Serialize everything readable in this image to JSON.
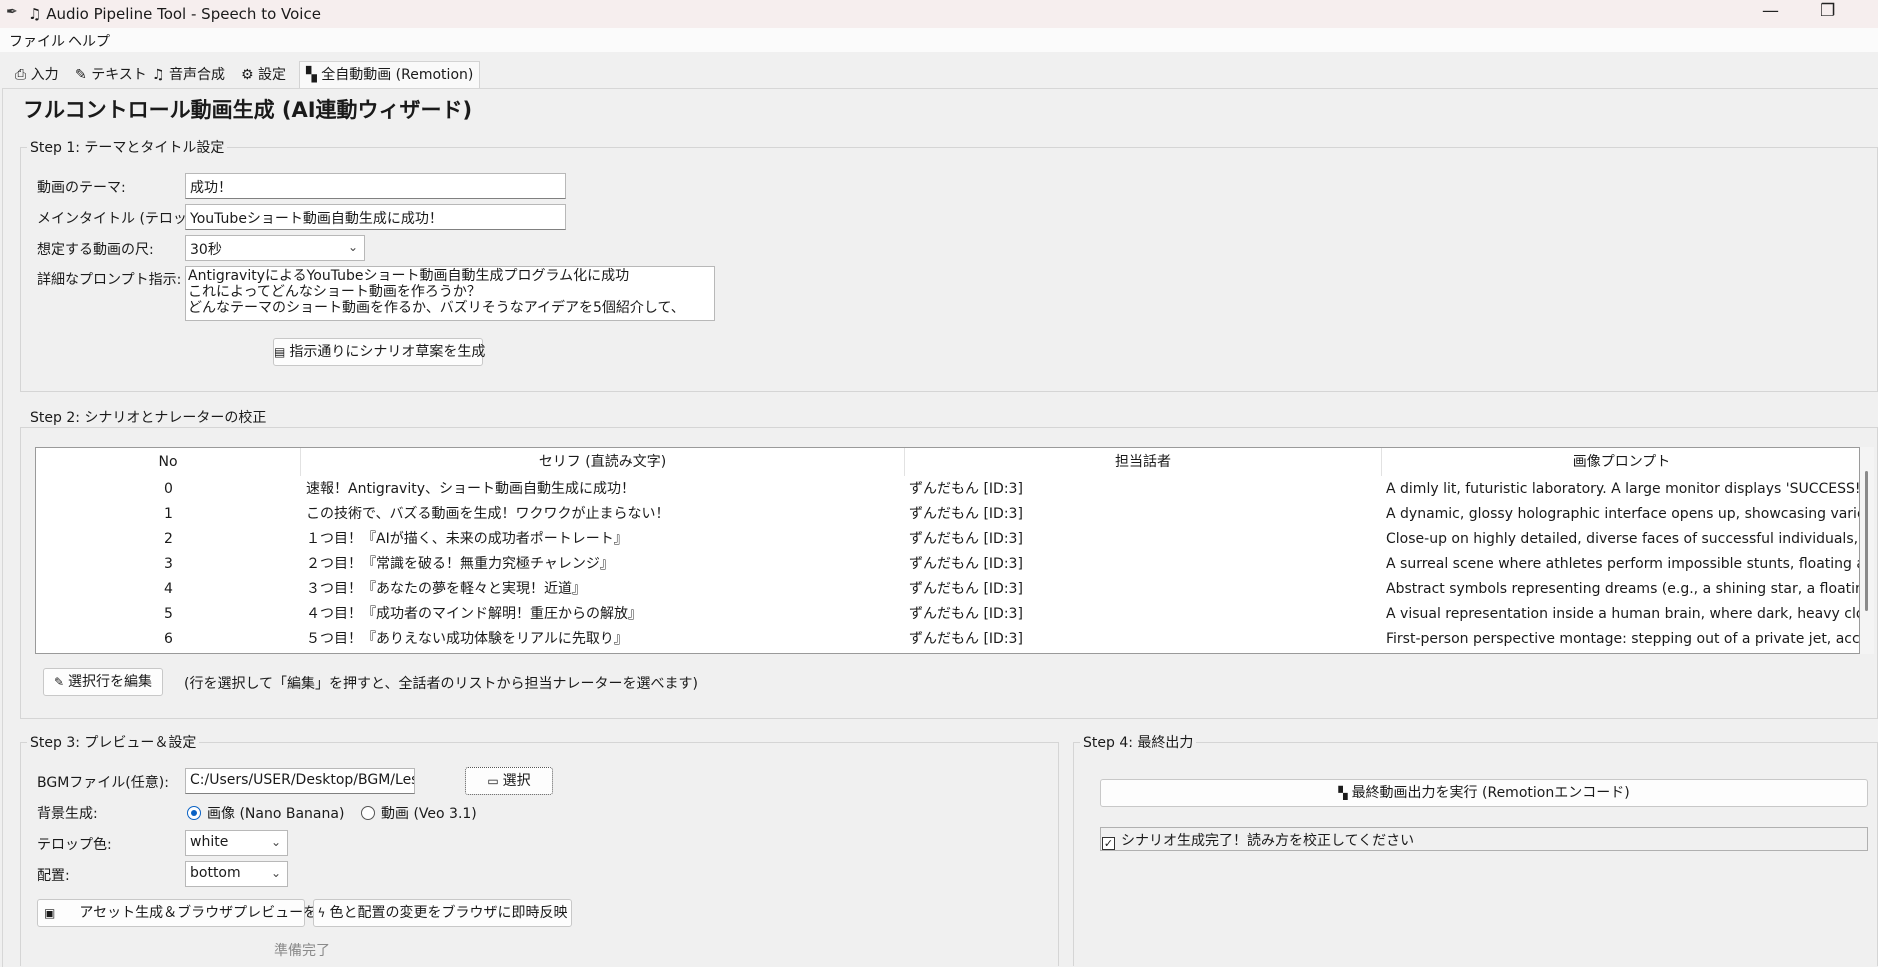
{
  "window": {
    "title": "Audio Pipeline Tool - Speech to Voice",
    "minimize_glyph": "—",
    "restore_glyph": "❐"
  },
  "menu": {
    "items": [
      "ファイル",
      "ヘルプ"
    ]
  },
  "tabs": [
    {
      "label": "入力",
      "icon": "import-icon"
    },
    {
      "label": "テキスト",
      "icon": "pencil-icon"
    },
    {
      "label": "音声合成",
      "icon": "music-note-icon"
    },
    {
      "label": "設定",
      "icon": "gear-icon"
    },
    {
      "label": "全自動動画 (Remotion)",
      "icon": "clapper-icon",
      "active": true
    }
  ],
  "heading": "フルコントロール動画生成 (AI連動ウィザード)",
  "step1": {
    "title": "Step 1: テーマとタイトル設定",
    "theme_label": "動画のテーマ:",
    "theme_value": "成功！",
    "main_title_label": "メインタイトル (テロップ):",
    "main_title_value": "YouTubeショート動画自動生成に成功！",
    "duration_label": "想定する動画の尺:",
    "duration_value": "30秒",
    "prompt_label": "詳細なプロンプト指示:",
    "prompt_lines": [
      "AntigravityによるYouTubeショート動画自動生成プログラム化に成功",
      "これによってどんなショート動画を作ろうか？",
      "どんなテーマのショート動画を作るか、バズリそうなアイデアを5個紹介して、"
    ],
    "generate_button": "指示通りにシナリオ草案を生成"
  },
  "step2": {
    "title": "Step 2: シナリオとナレーターの校正",
    "columns": [
      "No",
      "セリフ (直読み文字)",
      "担当話者",
      "画像プロンプト"
    ],
    "rows": [
      {
        "no": "0",
        "line": "速報！Antigravity、ショート動画自動生成に成功！",
        "speaker": "ずんだもん [ID:3]",
        "prompt": "A dimly lit, futuristic laboratory. A large monitor displays 'SUCCESS!' in g"
      },
      {
        "no": "1",
        "line": "この技術で、バズる動画を生成！ワクワクが止まらない！",
        "speaker": "ずんだもん [ID:3]",
        "prompt": "A dynamic, glossy holographic interface opens up, showcasing various"
      },
      {
        "no": "2",
        "line": "１つ目！『AIが描く、未来の成功者ポートレート』",
        "speaker": "ずんだもん [ID:3]",
        "prompt": "Close-up on highly detailed, diverse faces of successful individuals, shir"
      },
      {
        "no": "3",
        "line": "２つ目！『常識を破る！無重力究極チャレンジ』",
        "speaker": "ずんだもん [ID:3]",
        "prompt": "A surreal scene where athletes perform impossible stunts, floating and tr"
      },
      {
        "no": "4",
        "line": "３つ目！『あなたの夢を軽々と実現！近道』",
        "speaker": "ずんだもん [ID:3]",
        "prompt": "Abstract symbols representing dreams (e.g., a shining star, a floating trc"
      },
      {
        "no": "5",
        "line": "４つ目！『成功者のマインド解明！重圧からの解放』",
        "speaker": "ずんだもん [ID:3]",
        "prompt": "A visual representation inside a human brain, where dark, heavy clouds"
      },
      {
        "no": "6",
        "line": "５つ目！『ありえない成功体験をリアルに先取り』",
        "speaker": "ずんだもん [ID:3]",
        "prompt": "First-person perspective montage: stepping out of a private jet, acceptir"
      }
    ],
    "edit_button": "選択行を編集",
    "hint": "(行を選択して「編集」を押すと、全話者のリストから担当ナレーターを選べます)"
  },
  "step3": {
    "title": "Step 3: プレビュー＆設定",
    "bgm_label": "BGMファイル(任意):",
    "bgm_value": "C:/Users/USER/Desktop/BGM/Les",
    "select_button": "選択",
    "bg_label": "背景生成:",
    "bg_option_image": "画像 (Nano Banana)",
    "bg_option_video": "動画 (Veo 3.1)",
    "telop_color_label": "テロップ色:",
    "telop_color_value": "white",
    "position_label": "配置:",
    "position_value": "bottom",
    "asset_button": "アセット生成＆ブラウザプレビューを開く",
    "apply_button": "色と配置の変更をブラウザに即時反映",
    "status": "準備完了"
  },
  "step4": {
    "title": "Step 4: 最終出力",
    "export_button": "最終動画出力を実行 (Remotionエンコード)",
    "status_text": "シナリオ生成完了！読み方を校正してください"
  },
  "colors": {
    "accent": "#0a62c4",
    "titlebar": "#f6eeee",
    "background": "#f0f0f0"
  }
}
